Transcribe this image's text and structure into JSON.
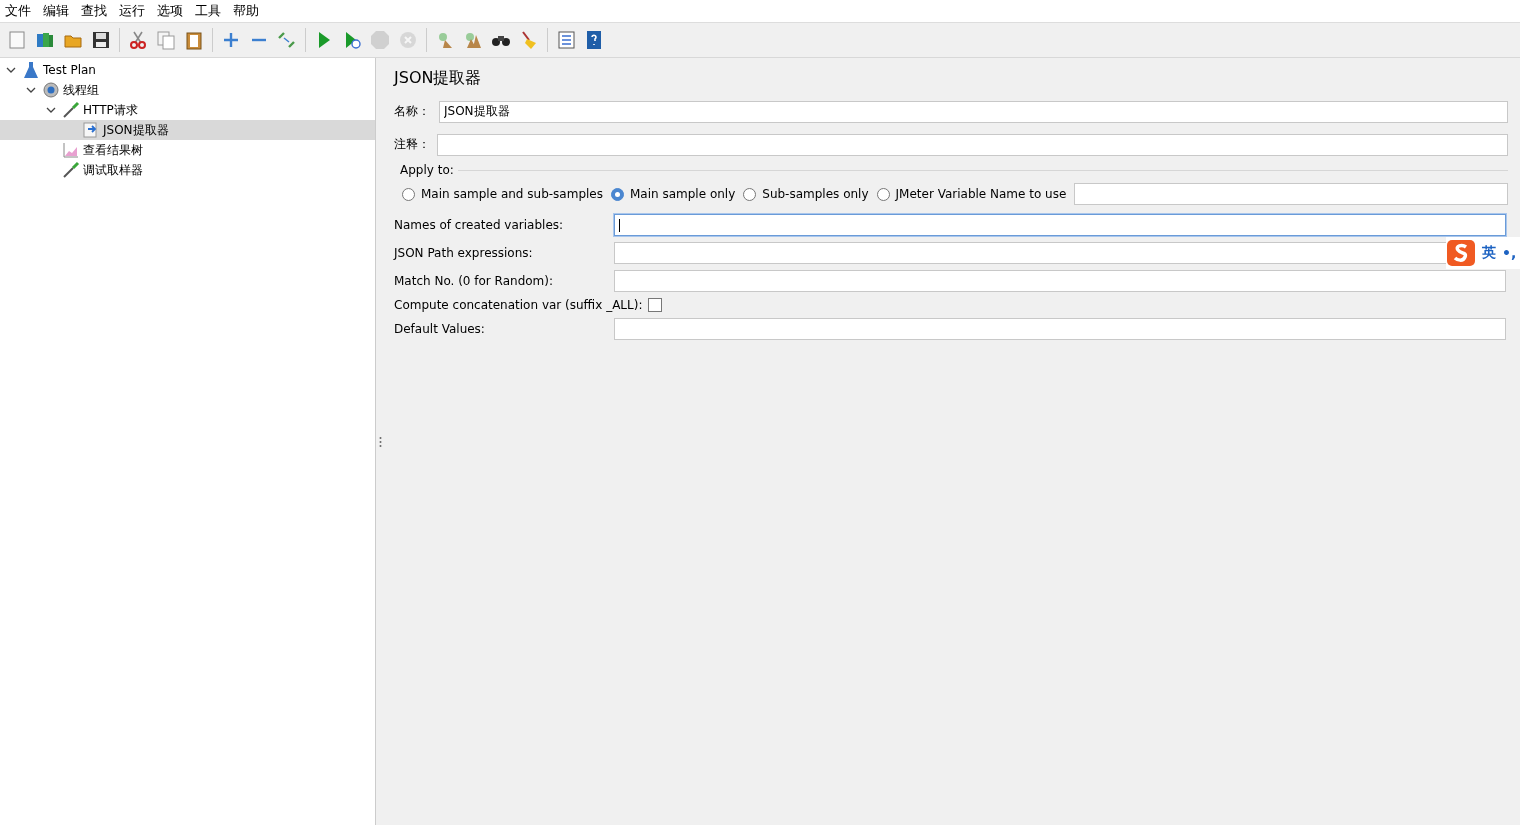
{
  "menu": [
    "文件",
    "编辑",
    "查找",
    "运行",
    "选项",
    "工具",
    "帮助"
  ],
  "toolbar": [
    {
      "kind": "new",
      "disabled": false
    },
    {
      "kind": "templates",
      "disabled": false
    },
    {
      "kind": "open",
      "disabled": false
    },
    {
      "kind": "save",
      "disabled": false
    },
    {
      "kind": "sep"
    },
    {
      "kind": "cut",
      "disabled": false
    },
    {
      "kind": "copy",
      "disabled": false
    },
    {
      "kind": "paste",
      "disabled": false
    },
    {
      "kind": "sep"
    },
    {
      "kind": "expand",
      "disabled": false
    },
    {
      "kind": "collapse",
      "disabled": false
    },
    {
      "kind": "toggle",
      "disabled": false
    },
    {
      "kind": "sep"
    },
    {
      "kind": "start",
      "disabled": false
    },
    {
      "kind": "start-no-pause",
      "disabled": false
    },
    {
      "kind": "stop",
      "disabled": true
    },
    {
      "kind": "shutdown",
      "disabled": true
    },
    {
      "kind": "sep"
    },
    {
      "kind": "clear",
      "disabled": false
    },
    {
      "kind": "clear-all",
      "disabled": false
    },
    {
      "kind": "search",
      "disabled": false
    },
    {
      "kind": "reset-search",
      "disabled": false
    },
    {
      "kind": "sep"
    },
    {
      "kind": "functions",
      "disabled": false
    },
    {
      "kind": "help",
      "disabled": false
    }
  ],
  "tree": [
    {
      "label": "Test Plan",
      "kind": "plan",
      "expanded": true,
      "selected": false,
      "children": [
        {
          "label": "线程组",
          "kind": "group",
          "expanded": true,
          "selected": false,
          "children": [
            {
              "label": "HTTP请求",
              "kind": "sampler",
              "expanded": true,
              "selected": false,
              "children": [
                {
                  "label": "JSON提取器",
                  "kind": "extractor",
                  "selected": true
                }
              ]
            },
            {
              "label": "查看结果树",
              "kind": "listener",
              "selected": false
            },
            {
              "label": "调试取样器",
              "kind": "sampler",
              "selected": false
            }
          ]
        }
      ]
    }
  ],
  "panel": {
    "title": "JSON提取器",
    "name": {
      "label": "名称：",
      "value": "JSON提取器"
    },
    "comment": {
      "label": "注释："
    },
    "apply_to": {
      "legend": "Apply to:",
      "options": [
        {
          "label": "Main sample and sub-samples",
          "selected": false
        },
        {
          "label": "Main sample only",
          "selected": true
        },
        {
          "label": "Sub-samples only",
          "selected": false
        },
        {
          "label": "JMeter Variable Name to use",
          "selected": false
        }
      ]
    },
    "fields": [
      {
        "kind": "text",
        "label": "Names of created variables:",
        "focused": true
      },
      {
        "kind": "text",
        "label": "JSON Path expressions:",
        "focused": false
      },
      {
        "kind": "text",
        "label": "Match No. (0 for Random):",
        "focused": false
      },
      {
        "kind": "checkbox",
        "label": "Compute concatenation var (suffix _ALL):",
        "checked": false
      },
      {
        "kind": "text",
        "label": "Default Values:",
        "focused": false
      }
    ]
  },
  "ime": {
    "mode": "英",
    "extra": "•,"
  }
}
